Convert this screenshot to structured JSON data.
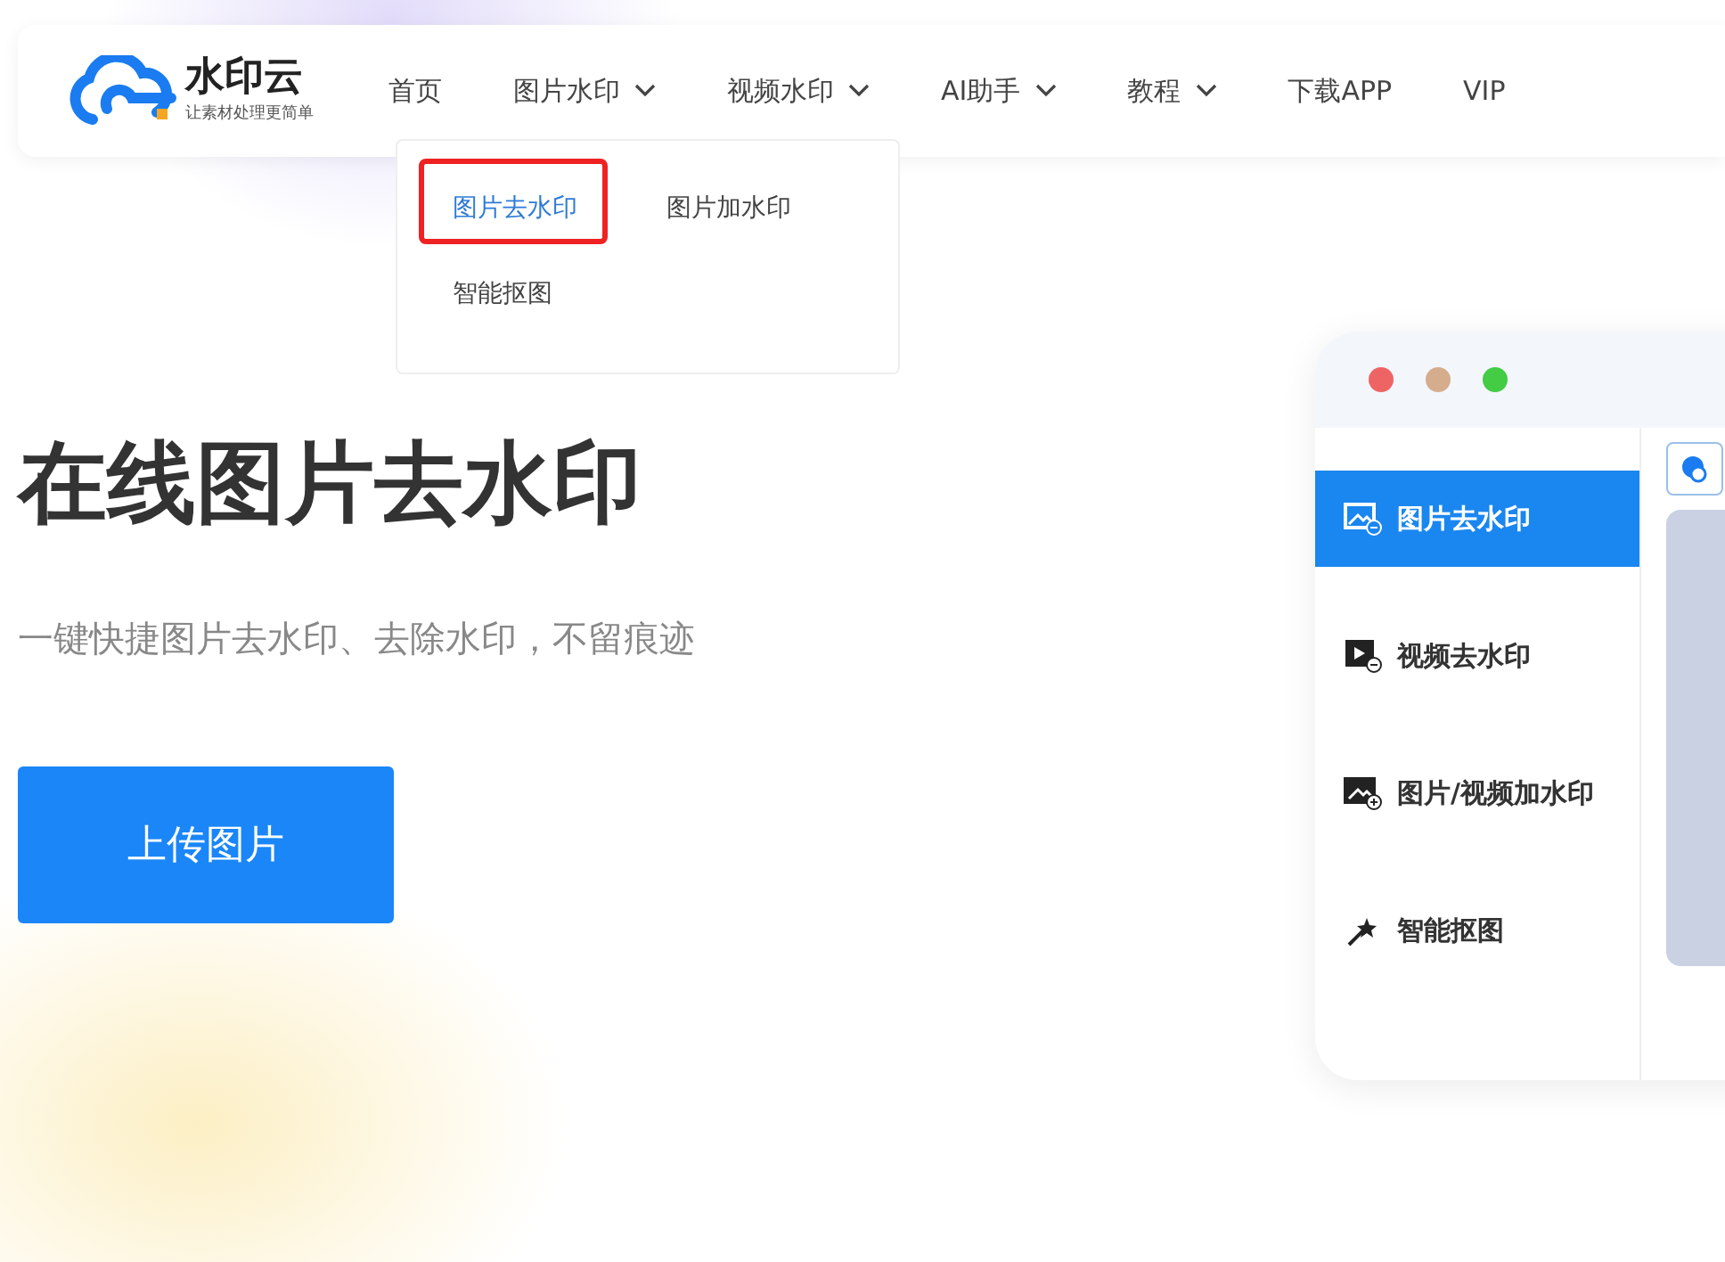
{
  "header": {
    "logo": {
      "name": "水印云",
      "tagline": "让素材处理更简单"
    },
    "nav": [
      {
        "label": "首页",
        "dropdown": false
      },
      {
        "label": "图片水印",
        "dropdown": true
      },
      {
        "label": "视频水印",
        "dropdown": true
      },
      {
        "label": "AI助手",
        "dropdown": true
      },
      {
        "label": "教程",
        "dropdown": true
      },
      {
        "label": "下载APP",
        "dropdown": false
      },
      {
        "label": "VIP",
        "dropdown": false
      }
    ]
  },
  "dropdown_menu": {
    "items": [
      {
        "label": "图片去水印",
        "selected": true
      },
      {
        "label": "图片加水印",
        "selected": false
      },
      {
        "label": "智能抠图",
        "selected": false
      }
    ]
  },
  "hero": {
    "title": "在线图片去水印",
    "subtitle": "一键快捷图片去水印、去除水印，不留痕迹",
    "button": "上传图片"
  },
  "app_preview": {
    "window_dots": [
      {
        "color": "#ee6464"
      },
      {
        "color": "#d6ad8c"
      },
      {
        "color": "#44cc44"
      }
    ],
    "sidebar": [
      {
        "kind": "image-remove",
        "label": "图片去水印",
        "selected": true
      },
      {
        "kind": "video-remove",
        "label": "视频去水印",
        "selected": false
      },
      {
        "kind": "image-add",
        "label": "图片/视频加水印",
        "selected": false
      },
      {
        "kind": "wand",
        "label": "智能抠图",
        "selected": false
      }
    ]
  }
}
